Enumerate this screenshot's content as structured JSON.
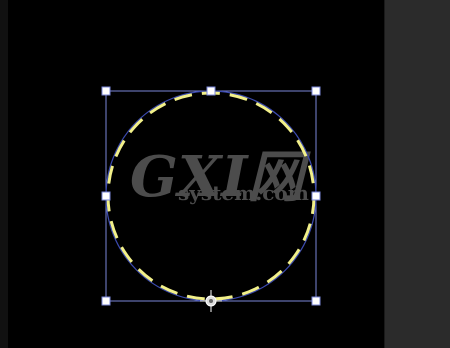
{
  "window": {
    "title": ""
  },
  "colors": {
    "canvas": "#000000",
    "panel": "#2b2b2b",
    "bounding_box": "#7a86d8",
    "path_outline": "#3c4bb0",
    "dashed_stroke": "#f2f08a",
    "handle_fill": "#ffffff",
    "watermark": "#8a8a8a"
  },
  "selection": {
    "shape": "ellipse",
    "stroke_style": "dashed",
    "handles": [
      "top-left",
      "top-center",
      "top-right",
      "middle-left",
      "middle-right",
      "bottom-left",
      "bottom-right"
    ],
    "pivot": "bottom-center"
  },
  "watermark": {
    "logo_text": "GXI网",
    "site_text": "system.com"
  }
}
